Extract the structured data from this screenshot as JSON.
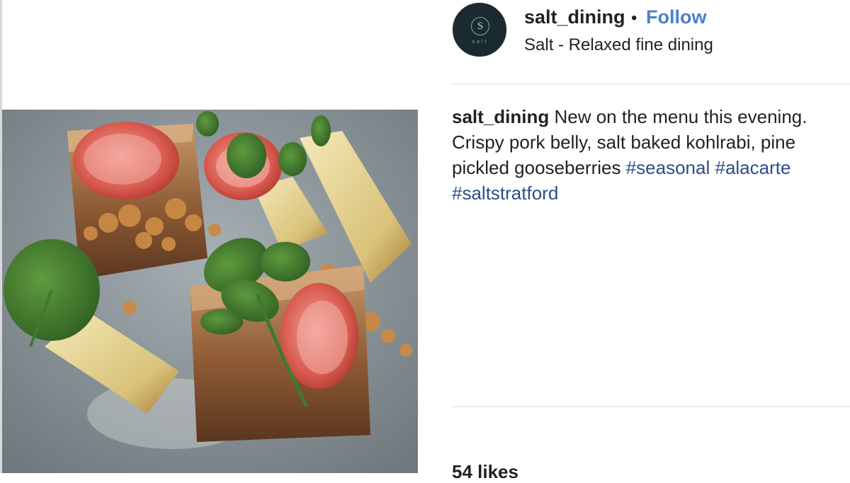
{
  "post": {
    "image_alt": "plated dish with pork belly, tomatoes, kohlrabi and watercress",
    "header": {
      "username": "salt_dining",
      "separator": "•",
      "follow_label": "Follow",
      "location": "Salt - Relaxed fine dining",
      "avatar_letter": "S",
      "avatar_word": "salt"
    },
    "caption": {
      "username": "salt_dining",
      "text": "New on the menu this evening. Crispy pork belly, salt baked kohlrabi, pine pickled gooseberries",
      "hashtags": [
        "#seasonal",
        "#alacarte",
        "#saltstratford"
      ]
    },
    "likes_label": "54 likes"
  },
  "colors": {
    "follow": "#4a82c8",
    "hashtag": "#2d4e87",
    "avatar_bg": "#1a2a31",
    "plate": "#8c969b"
  }
}
